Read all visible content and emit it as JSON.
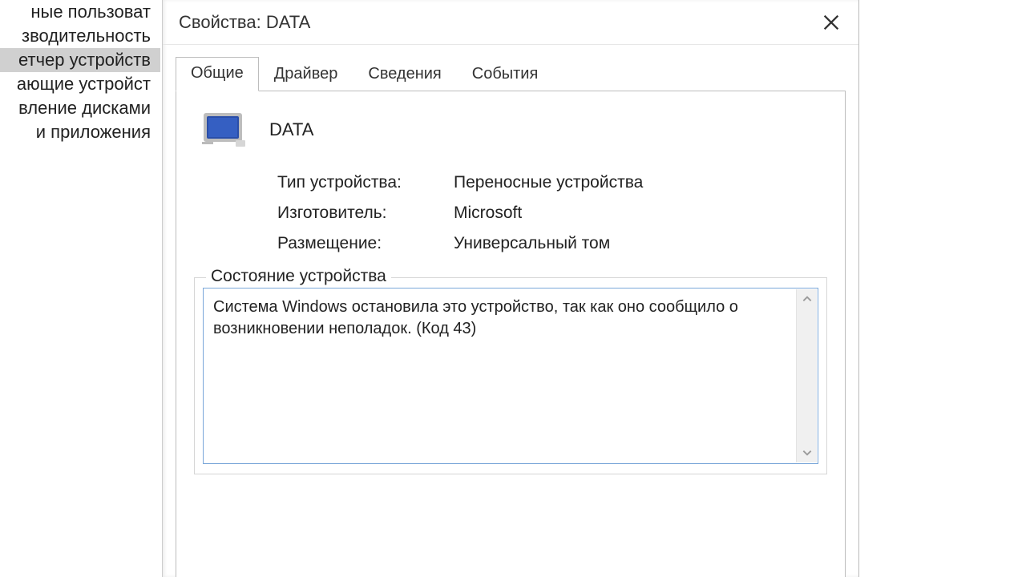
{
  "background_sidebar": {
    "items": [
      {
        "label": "ные пользоват",
        "selected": false
      },
      {
        "label": "зводительность",
        "selected": false
      },
      {
        "label": "етчер устройств",
        "selected": true
      },
      {
        "label": "ающие устройст",
        "selected": false
      },
      {
        "label": "вление дисками",
        "selected": false
      },
      {
        "label": "и приложения",
        "selected": false
      }
    ]
  },
  "dialog": {
    "title": "Свойства: DATA",
    "tabs": [
      {
        "label": "Общие",
        "active": true
      },
      {
        "label": "Драйвер",
        "active": false
      },
      {
        "label": "Сведения",
        "active": false
      },
      {
        "label": "События",
        "active": false
      }
    ],
    "device": {
      "name": "DATA",
      "type_label": "Тип устройства:",
      "type_value": "Переносные устройства",
      "manufacturer_label": "Изготовитель:",
      "manufacturer_value": "Microsoft",
      "location_label": "Размещение:",
      "location_value": "Универсальный том"
    },
    "status_group": {
      "legend": "Состояние устройства",
      "text": "Система Windows остановила это устройство, так как оно сообщило о возникновении неполадок. (Код 43)"
    }
  }
}
